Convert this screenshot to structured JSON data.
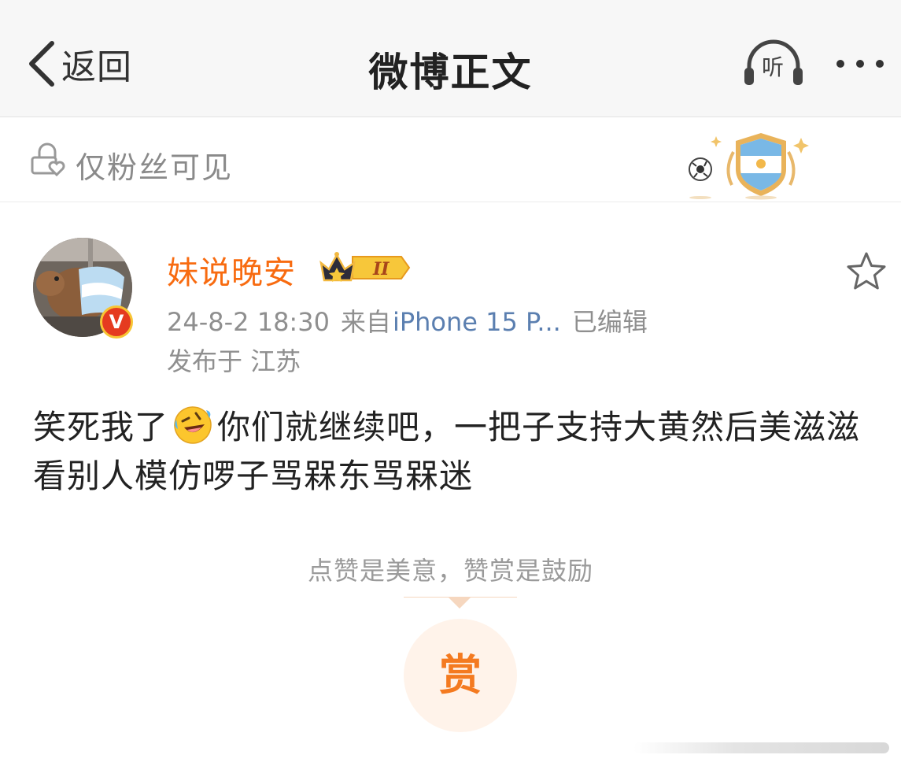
{
  "nav": {
    "back_label": "返回",
    "title": "微博正文",
    "listen_label": "听"
  },
  "visibility": {
    "label": "仅粉丝可见"
  },
  "post": {
    "author": "妹说晚安",
    "level_badge": "II",
    "verified_label": "V",
    "time": "24-8-2 18:30",
    "source_prefix": "来自",
    "source": "iPhone 15 P...",
    "edited": "已编辑",
    "location": "发布于 江苏",
    "text_before_emoji": "笑死我了",
    "emoji": "rolling-on-floor-laughing-icon",
    "text_after_emoji": "你们就继续吧，一把子支持大黄然后美滋滋看别人模仿啰子骂槑东骂槑迷"
  },
  "reward": {
    "hint": "点赞是美意，赞赏是鼓励",
    "button_label": "赏"
  },
  "colors": {
    "accent": "#f86b10",
    "link": "#5b7fb0",
    "reward": "#f47a20"
  }
}
